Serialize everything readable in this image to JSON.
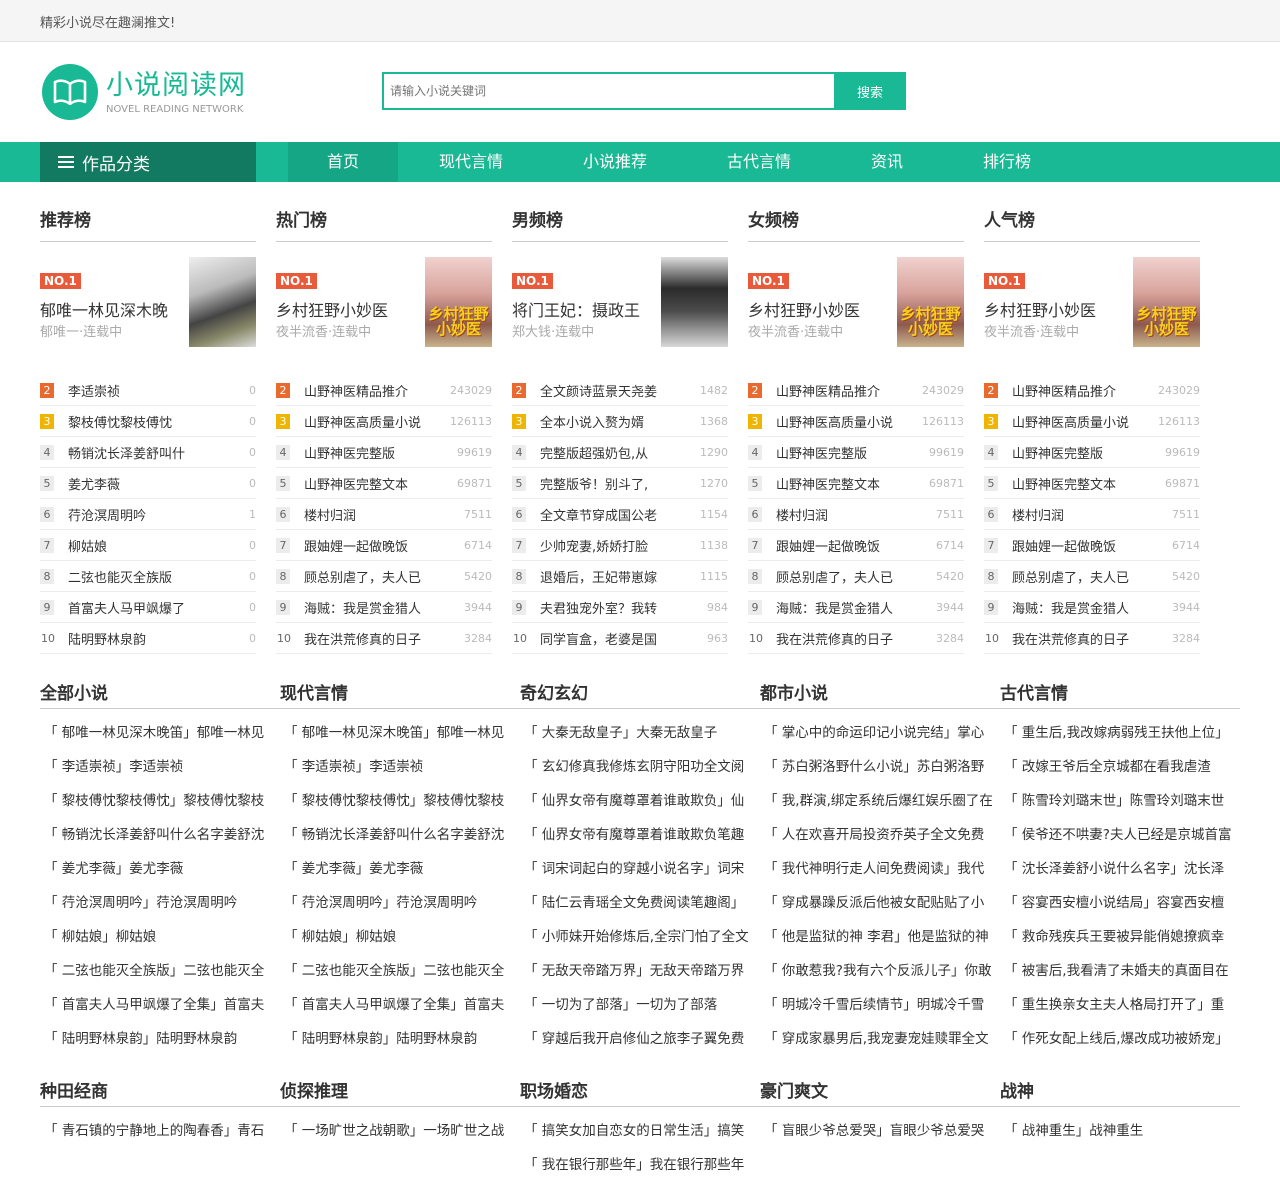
{
  "top_bar": {
    "slogan": "精彩小说尽在趣澜推文!"
  },
  "logo": {
    "main": "小说阅读网",
    "sub": "NOVEL READING NETWORK"
  },
  "search": {
    "placeholder": "请输入小说关键词",
    "button": "搜索"
  },
  "nav": {
    "category_label": "作品分类",
    "items": [
      "首页",
      "现代言情",
      "小说推荐",
      "古代言情",
      "资讯",
      "排行榜"
    ]
  },
  "ranks": [
    {
      "title": "推荐榜",
      "badge": "NO.1",
      "top_name": "郁唯一林见深木晚",
      "top_author": "郁唯一·连载中",
      "cover_text": "",
      "items": [
        {
          "n": "2",
          "name": "李适崇祯",
          "count": "0"
        },
        {
          "n": "3",
          "name": "黎枝傅忱黎枝傅忱",
          "count": "0"
        },
        {
          "n": "4",
          "name": "畅销沈长泽姜舒叫什",
          "count": "0"
        },
        {
          "n": "5",
          "name": "姜尤李薇",
          "count": "0"
        },
        {
          "n": "6",
          "name": "荇沧溟周明吟",
          "count": "1"
        },
        {
          "n": "7",
          "name": "柳姑娘",
          "count": "0"
        },
        {
          "n": "8",
          "name": "二弦也能灭全族版",
          "count": "0"
        },
        {
          "n": "9",
          "name": "首富夫人马甲飒爆了",
          "count": "0"
        },
        {
          "n": "10",
          "name": "陆明野林泉韵",
          "count": "0"
        }
      ]
    },
    {
      "title": "热门榜",
      "badge": "NO.1",
      "top_name": "乡村狂野小妙医",
      "top_author": "夜半流香·连载中",
      "cover_text": "乡村狂野小妙医",
      "items": [
        {
          "n": "2",
          "name": "山野神医精品推介",
          "count": "243029"
        },
        {
          "n": "3",
          "name": "山野神医高质量小说",
          "count": "126113"
        },
        {
          "n": "4",
          "name": "山野神医完整版",
          "count": "99619"
        },
        {
          "n": "5",
          "name": "山野神医完整文本",
          "count": "69871"
        },
        {
          "n": "6",
          "name": "楼村归润",
          "count": "7511"
        },
        {
          "n": "7",
          "name": "跟妯娌一起做晚饭",
          "count": "6714"
        },
        {
          "n": "8",
          "name": "顾总别虐了，夫人已",
          "count": "5420"
        },
        {
          "n": "9",
          "name": "海贼：我是赏金猎人",
          "count": "3944"
        },
        {
          "n": "10",
          "name": "我在洪荒修真的日子",
          "count": "3284"
        }
      ]
    },
    {
      "title": "男频榜",
      "badge": "NO.1",
      "top_name": "将门王妃：摄政王",
      "top_author": "郑大钱·连载中",
      "cover_text": "",
      "items": [
        {
          "n": "2",
          "name": "全文颜诗蓝景天尧姜",
          "count": "1482"
        },
        {
          "n": "3",
          "name": "全本小说入赘为婿",
          "count": "1368"
        },
        {
          "n": "4",
          "name": "完整版超强奶包,从",
          "count": "1290"
        },
        {
          "n": "5",
          "name": "完整版爷！别斗了,",
          "count": "1270"
        },
        {
          "n": "6",
          "name": "全文章节穿成国公老",
          "count": "1154"
        },
        {
          "n": "7",
          "name": "少帅宠妻,娇娇打脸",
          "count": "1138"
        },
        {
          "n": "8",
          "name": "退婚后，王妃带崽嫁",
          "count": "1115"
        },
        {
          "n": "9",
          "name": "夫君独宠外室？我转",
          "count": "984"
        },
        {
          "n": "10",
          "name": "同学盲盒，老婆是国",
          "count": "963"
        }
      ]
    },
    {
      "title": "女频榜",
      "badge": "NO.1",
      "top_name": "乡村狂野小妙医",
      "top_author": "夜半流香·连载中",
      "cover_text": "乡村狂野小妙医",
      "items": [
        {
          "n": "2",
          "name": "山野神医精品推介",
          "count": "243029"
        },
        {
          "n": "3",
          "name": "山野神医高质量小说",
          "count": "126113"
        },
        {
          "n": "4",
          "name": "山野神医完整版",
          "count": "99619"
        },
        {
          "n": "5",
          "name": "山野神医完整文本",
          "count": "69871"
        },
        {
          "n": "6",
          "name": "楼村归润",
          "count": "7511"
        },
        {
          "n": "7",
          "name": "跟妯娌一起做晚饭",
          "count": "6714"
        },
        {
          "n": "8",
          "name": "顾总别虐了，夫人已",
          "count": "5420"
        },
        {
          "n": "9",
          "name": "海贼：我是赏金猎人",
          "count": "3944"
        },
        {
          "n": "10",
          "name": "我在洪荒修真的日子",
          "count": "3284"
        }
      ]
    },
    {
      "title": "人气榜",
      "badge": "NO.1",
      "top_name": "乡村狂野小妙医",
      "top_author": "夜半流香·连载中",
      "cover_text": "乡村狂野小妙医",
      "items": [
        {
          "n": "2",
          "name": "山野神医精品推介",
          "count": "243029"
        },
        {
          "n": "3",
          "name": "山野神医高质量小说",
          "count": "126113"
        },
        {
          "n": "4",
          "name": "山野神医完整版",
          "count": "99619"
        },
        {
          "n": "5",
          "name": "山野神医完整文本",
          "count": "69871"
        },
        {
          "n": "6",
          "name": "楼村归润",
          "count": "7511"
        },
        {
          "n": "7",
          "name": "跟妯娌一起做晚饭",
          "count": "6714"
        },
        {
          "n": "8",
          "name": "顾总别虐了，夫人已",
          "count": "5420"
        },
        {
          "n": "9",
          "name": "海贼：我是赏金猎人",
          "count": "3944"
        },
        {
          "n": "10",
          "name": "我在洪荒修真的日子",
          "count": "3284"
        }
      ]
    }
  ],
  "categories1": [
    {
      "title": "全部小说",
      "items": [
        "「 郁唯一林见深木晚笛」郁唯一林见",
        "「 李适崇祯」李适崇祯",
        "「 黎枝傅忱黎枝傅忱」黎枝傅忱黎枝",
        "「 畅销沈长泽姜舒叫什么名字姜舒沈",
        "「 姜尤李薇」姜尤李薇",
        "「 荇沧溟周明吟」荇沧溟周明吟",
        "「 柳姑娘」柳姑娘",
        "「 二弦也能灭全族版」二弦也能灭全",
        "「 首富夫人马甲飒爆了全集」首富夫",
        "「 陆明野林泉韵」陆明野林泉韵"
      ]
    },
    {
      "title": "现代言情",
      "items": [
        "「 郁唯一林见深木晚笛」郁唯一林见",
        "「 李适崇祯」李适崇祯",
        "「 黎枝傅忱黎枝傅忱」黎枝傅忱黎枝",
        "「 畅销沈长泽姜舒叫什么名字姜舒沈",
        "「 姜尤李薇」姜尤李薇",
        "「 荇沧溟周明吟」荇沧溟周明吟",
        "「 柳姑娘」柳姑娘",
        "「 二弦也能灭全族版」二弦也能灭全",
        "「 首富夫人马甲飒爆了全集」首富夫",
        "「 陆明野林泉韵」陆明野林泉韵"
      ]
    },
    {
      "title": "奇幻玄幻",
      "items": [
        "「 大秦无敌皇子」大秦无敌皇子",
        "「 玄幻修真我修炼玄阴守阳功全文阅",
        "「 仙界女帝有魔尊罩着谁敢欺负」仙",
        "「 仙界女帝有魔尊罩着谁敢欺负笔趣",
        "「 词宋词起白的穿越小说名字」词宋",
        "「 陆仁云青瑶全文免费阅读笔趣阁」",
        "「 小师妹开始修炼后,全宗门怕了全文",
        "「 无敌天帝踏万界」无敌天帝踏万界",
        "「 一切为了部落」一切为了部落",
        "「 穿越后我开启修仙之旅李子翼免费"
      ]
    },
    {
      "title": "都市小说",
      "items": [
        "「 掌心中的命运印记小说完结」掌心",
        "「 苏白粥洛野什么小说」苏白粥洛野",
        "「 我,群演,绑定系统后爆红娱乐圈了在",
        "「 人在欢喜开局投资乔英子全文免费",
        "「 我代神明行走人间免费阅读」我代",
        "「 穿成暴躁反派后他被女配贴贴了小",
        "「 他是监狱的神 李君」他是监狱的神",
        "「 你敢惹我?我有六个反派儿子」你敢",
        "「 明城冷千雪后续情节」明城冷千雪",
        "「 穿成家暴男后,我宠妻宠娃赎罪全文"
      ]
    },
    {
      "title": "古代言情",
      "items": [
        "「 重生后,我改嫁病弱残王扶他上位」",
        "「 改嫁王爷后全京城都在看我虐渣",
        "「 陈雪玲刘璐末世」陈雪玲刘璐末世",
        "「 侯爷还不哄妻?夫人已经是京城首富",
        "「 沈长泽姜舒小说什么名字」沈长泽",
        "「 容宴西安檀小说结局」容宴西安檀",
        "「 救命残疾兵王要被异能俏媳撩疯幸",
        "「 被害后,我看清了未婚夫的真面目在",
        "「 重生换亲女主夫人格局打开了」重",
        "「 作死女配上线后,爆改成功被娇宠」"
      ]
    }
  ],
  "categories2": [
    {
      "title": "种田经商",
      "items": [
        "「 青石镇的宁静地上的陶春香」青石"
      ]
    },
    {
      "title": "侦探推理",
      "items": [
        "「 一场旷世之战朝歌」一场旷世之战"
      ]
    },
    {
      "title": "职场婚恋",
      "items": [
        "「 搞笑女加自恋女的日常生活」搞笑",
        "「 我在银行那些年」我在银行那些年"
      ]
    },
    {
      "title": "豪门爽文",
      "items": [
        "「 盲眼少爷总爱哭」盲眼少爷总爱哭"
      ]
    },
    {
      "title": "战神",
      "items": [
        "「 战神重生」战神重生"
      ]
    }
  ]
}
